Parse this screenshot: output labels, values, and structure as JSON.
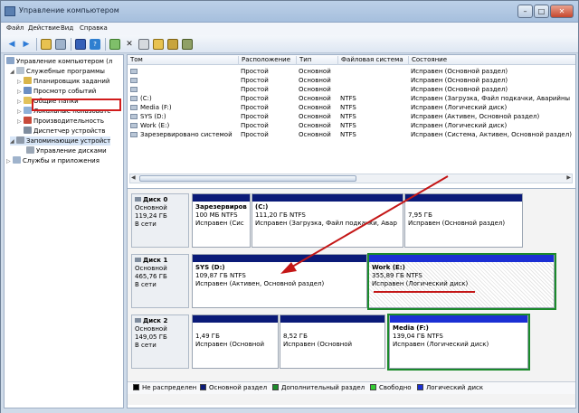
{
  "window": {
    "title": "Управление компьютером"
  },
  "menu": {
    "items": [
      "Файл",
      "Действие",
      "Вид",
      "Справка"
    ]
  },
  "tree": {
    "items": [
      {
        "label": "Управление компьютером (л"
      },
      {
        "label": "Служебные программы"
      },
      {
        "label": "Планировщик заданий"
      },
      {
        "label": "Просмотр событий"
      },
      {
        "label": "Общие папки"
      },
      {
        "label": "Локальные пользовате"
      },
      {
        "label": "Производительность"
      },
      {
        "label": "Диспетчер устройств"
      },
      {
        "label": "Запоминающие устройст"
      },
      {
        "label": "Управление дисками"
      },
      {
        "label": "Службы и приложения"
      }
    ]
  },
  "volume_table": {
    "columns": [
      "Том",
      "Расположение",
      "Тип",
      "Файловая система",
      "Состояние"
    ],
    "rows": [
      {
        "vol": "",
        "layout": "Простой",
        "type": "Основной",
        "fs": "",
        "status": "Исправен (Основной раздел)"
      },
      {
        "vol": "",
        "layout": "Простой",
        "type": "Основной",
        "fs": "",
        "status": "Исправен (Основной раздел)"
      },
      {
        "vol": "",
        "layout": "Простой",
        "type": "Основной",
        "fs": "",
        "status": "Исправен (Основной раздел)"
      },
      {
        "vol": "(C:)",
        "layout": "Простой",
        "type": "Основной",
        "fs": "NTFS",
        "status": "Исправен (Загрузка, Файл подкачки, Аварийны"
      },
      {
        "vol": "Media (F:)",
        "layout": "Простой",
        "type": "Основной",
        "fs": "NTFS",
        "status": "Исправен (Логический диск)"
      },
      {
        "vol": "SYS (D:)",
        "layout": "Простой",
        "type": "Основной",
        "fs": "NTFS",
        "status": "Исправен (Активен, Основной раздел)"
      },
      {
        "vol": "Work (E:)",
        "layout": "Простой",
        "type": "Основной",
        "fs": "NTFS",
        "status": "Исправен (Логический диск)"
      },
      {
        "vol": "Зарезервировано системой",
        "layout": "Простой",
        "type": "Основной",
        "fs": "NTFS",
        "status": "Исправен (Система, Активен, Основной раздел)"
      }
    ]
  },
  "disks": [
    {
      "name": "Диск 0",
      "kind": "Основной",
      "size": "119,24 ГБ",
      "state": "В сети",
      "partitions": [
        {
          "name": "Зарезервиров",
          "size": "100 МБ NTFS",
          "status": "Исправен (Сис"
        },
        {
          "name": "(C:)",
          "size": "111,20 ГБ NTFS",
          "status": "Исправен (Загрузка, Файл подкачки, Авар"
        },
        {
          "name": "",
          "size": "7,95 ГБ",
          "status": "Исправен (Основной раздел)"
        }
      ]
    },
    {
      "name": "Диск 1",
      "kind": "Основной",
      "size": "465,76 ГБ",
      "state": "В сети",
      "partitions": [
        {
          "name": "SYS (D:)",
          "size": "109,87 ГБ NTFS",
          "status": "Исправен (Активен, Основной раздел)"
        },
        {
          "name": "Work (E:)",
          "size": "355,89 ГБ NTFS",
          "status": "Исправен (Логический диск)"
        }
      ]
    },
    {
      "name": "Диск 2",
      "kind": "Основной",
      "size": "149,05 ГБ",
      "state": "В сети",
      "partitions": [
        {
          "name": "",
          "size": "1,49 ГБ",
          "status": "Исправен (Основной"
        },
        {
          "name": "",
          "size": "8,52 ГБ",
          "status": "Исправен (Основной"
        },
        {
          "name": "Media (F:)",
          "size": "139,04 ГБ NTFS",
          "status": "Исправен (Логический диск)"
        }
      ]
    }
  ],
  "legend": {
    "items": [
      {
        "label": "Не распределен",
        "color": "#000000"
      },
      {
        "label": "Основной раздел",
        "color": "#0a1a78"
      },
      {
        "label": "Дополнительный раздел",
        "color": "#1b8a2b"
      },
      {
        "label": "Свободно",
        "color": "#33cc33"
      },
      {
        "label": "Логический диск",
        "color": "#1b2fd4"
      }
    ]
  },
  "colors": {
    "annotation": "#c41616",
    "highlight_green": "#1b8a2b",
    "primary_bar": "#0a1a78",
    "logical_bar": "#1b2fd4"
  }
}
